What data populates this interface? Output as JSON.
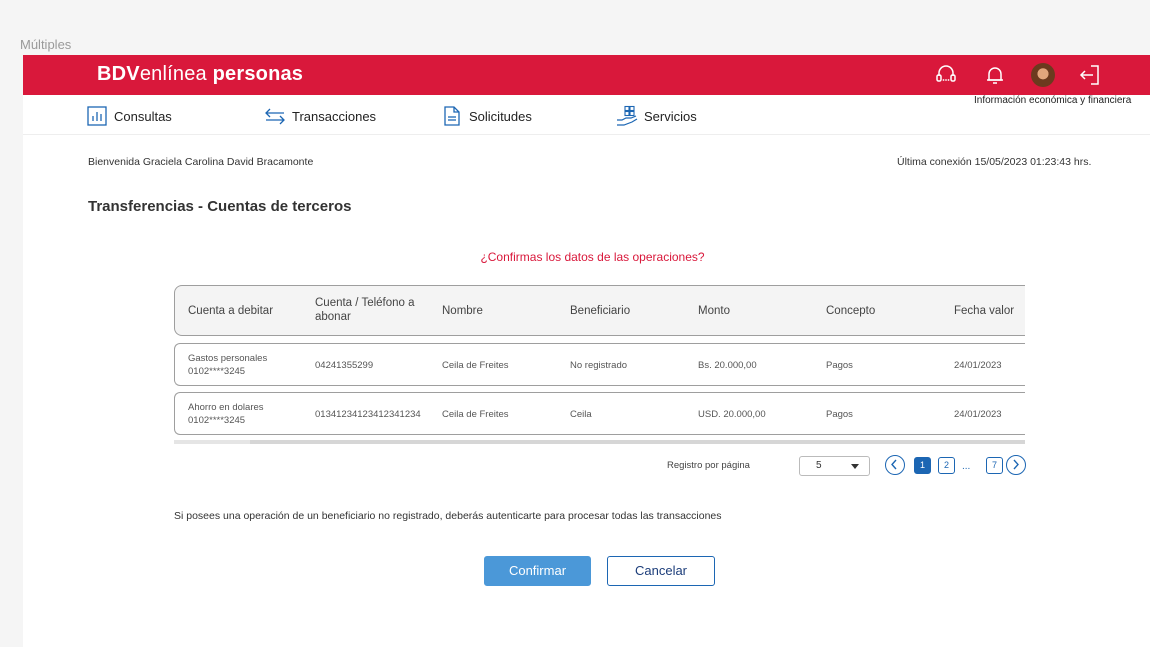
{
  "frame_label": "Múltiples",
  "brand": {
    "part1": "BDV",
    "part2": "enlínea",
    "part3": "personas"
  },
  "header": {
    "info_link": "Información económica y financiera"
  },
  "nav": [
    {
      "label": "Consultas",
      "icon": "chart-bars-icon"
    },
    {
      "label": "Transacciones",
      "icon": "transfer-arrows-icon"
    },
    {
      "label": "Solicitudes",
      "icon": "document-icon"
    },
    {
      "label": "Servicios",
      "icon": "hand-services-icon"
    }
  ],
  "welcome": "Bienvenida Graciela Carolina David Bracamonte",
  "last_connection": "Última conexión 15/05/2023 01:23:43 hrs.",
  "page_title": "Transferencias - Cuentas de terceros",
  "question": "¿Confirmas los datos de las operaciones?",
  "table": {
    "columns": [
      "Cuenta a debitar",
      "Cuenta / Teléfono a abonar",
      "Nombre",
      "Beneficiario",
      "Monto",
      "Concepto",
      "Fecha valor"
    ],
    "rows": [
      {
        "account_name": "Gastos personales",
        "account_number": "0102****3245",
        "destination": "04241355299",
        "name": "Ceila de Freites",
        "beneficiary": "No registrado",
        "amount": "Bs. 20.000,00",
        "concept": "Pagos",
        "date": "24/01/2023"
      },
      {
        "account_name": "Ahorro en dolares",
        "account_number": "0102****3245",
        "destination": "01341234123412341234",
        "name": "Ceila de Freites",
        "beneficiary": "Ceila",
        "amount": "USD. 20.000,00",
        "concept": "Pagos",
        "date": "24/01/2023"
      }
    ]
  },
  "pagination": {
    "per_page_label": "Registro por página",
    "per_page_value": "5",
    "pages": [
      "1",
      "2",
      "7"
    ],
    "ellipsis": "...",
    "current": "1"
  },
  "notice": "Si posees una operación de un beneficiario no registrado, deberás autenticarte para procesar todas las transacciones",
  "actions": {
    "confirm": "Confirmar",
    "cancel": "Cancelar"
  },
  "colors": {
    "brand_red": "#d9183b",
    "primary_blue": "#1c66b3",
    "button_blue": "#4b98d8"
  }
}
